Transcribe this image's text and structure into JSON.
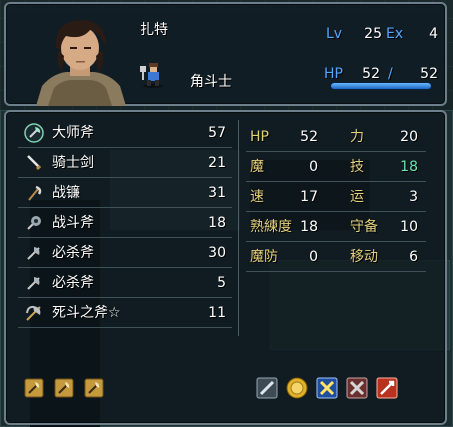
{
  "unit": {
    "name": "扎特",
    "class": "角斗士",
    "lv_label": "Lv",
    "lv": "25",
    "ex_label": "Ex",
    "ex": "4",
    "hp_label": "HP",
    "hp_current": "52",
    "hp_sep": "/",
    "hp_max": "52",
    "hp_fill_percent": 100
  },
  "inventory": [
    {
      "name": "大师斧",
      "uses": "57",
      "icon": "master-axe-icon"
    },
    {
      "name": "骑士剑",
      "uses": "21",
      "icon": "sword-icon"
    },
    {
      "name": "战镰",
      "uses": "31",
      "icon": "scythe-icon"
    },
    {
      "name": "战斗斧",
      "uses": "18",
      "icon": "battle-axe-icon"
    },
    {
      "name": "必杀斧",
      "uses": "30",
      "icon": "killer-axe-icon"
    },
    {
      "name": "必杀斧",
      "uses": "5",
      "icon": "killer-axe-icon"
    },
    {
      "name": "死斗之斧☆",
      "uses": "11",
      "icon": "death-axe-icon"
    }
  ],
  "stats": [
    {
      "label": "HP",
      "value": "52",
      "label2": "力",
      "value2": "20",
      "value2_color": "#ffffff"
    },
    {
      "label": "魔",
      "value": "0",
      "label2": "技",
      "value2": "18",
      "value2_color": "#6ee3b0"
    },
    {
      "label": "速",
      "value": "17",
      "label2": "运",
      "value2": "3",
      "value2_color": "#ffffff"
    },
    {
      "label": "熟練度",
      "value": "18",
      "label2": "守备",
      "value2": "10",
      "value2_color": "#ffffff"
    },
    {
      "label": "魔防",
      "value": "0",
      "label2": "移动",
      "value2": "6",
      "value2_color": "#ffffff"
    }
  ],
  "weapon_ranks": [
    "axe-rank-icon",
    "axe-rank-icon",
    "axe-rank-icon"
  ],
  "skills": [
    "sword-skill-icon",
    "gold-badge-icon",
    "crossed-swords-icon",
    "crossed-swords-gray-icon",
    "arrow-burst-icon"
  ]
}
